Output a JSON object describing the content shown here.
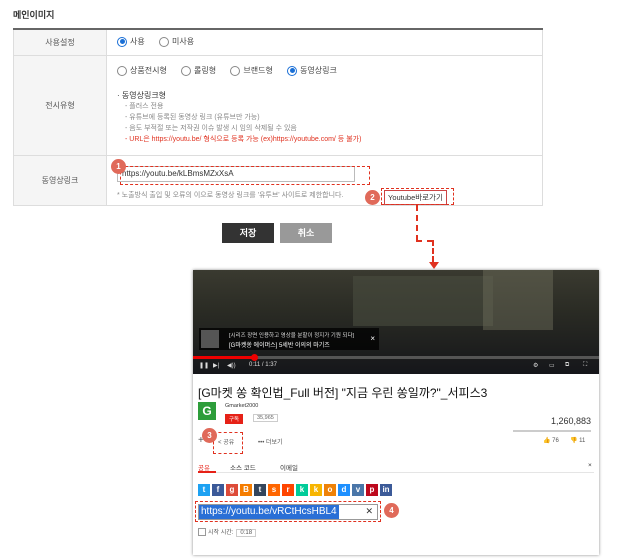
{
  "section_title": "메인이미지",
  "rows": {
    "usage": {
      "label": "사용설정",
      "options": [
        {
          "label": "사용",
          "selected": true
        },
        {
          "label": "미사용",
          "selected": false
        }
      ]
    },
    "display_type": {
      "label": "전시유형",
      "options": [
        {
          "label": "상품전시형",
          "selected": false
        },
        {
          "label": "롤링형",
          "selected": false
        },
        {
          "label": "브랜드형",
          "selected": false
        },
        {
          "label": "동영상링크",
          "selected": true
        }
      ],
      "guide_title": "· 동영상링크형",
      "guide_lines": [
        "- 플러스 전용",
        "- 유튜브에 등록된 동영상 링크 (유튜브만 가능)",
        "- 음도 부적절 또는 저작권 이슈 발생 시 임의 삭제될 수 있음",
        "- URL은 https://youtu.be/ 형식으로 등록 가능 (ex)https://youtube.com/ 등 불가)"
      ]
    },
    "video_link": {
      "label": "동영상링크",
      "input_value": "https://youtu.be/kLBmsMZxXsA",
      "note": "* 노출방식 출입 및 오류의 이으로 동영상 링크를 '유투브' 사이트로 제한합니다.",
      "youtube_link_label": "Youtube바로가기"
    }
  },
  "buttons": {
    "save": "저장",
    "cancel": "취소"
  },
  "badges": [
    "1",
    "2",
    "3",
    "4"
  ],
  "youtube": {
    "ad_line1": "[시리즈 장면 인용하고 영상을 분할이 정지가 기원 되다]",
    "ad_line2": "[G마켓쏭 에이머스] 5세반 이의의 마기즈",
    "progress": 0.15,
    "time": "0:11 / 1:37",
    "title": "[G마켓 쏭 확인법_Full 버전] \"지금 우린 쏭일까?\"_서피스3",
    "channel_logo": "G",
    "channel_name": "Gmarket2000",
    "subscribe": "구독",
    "subscriber_count": "35,965",
    "views": "1,260,883",
    "add_icon": "+",
    "share_label": "공유",
    "more_label": "••• 더보기",
    "likes": "76",
    "dislikes": "11",
    "tabs": [
      "공유",
      "소스 코드",
      "이메일"
    ],
    "close_icon": "×",
    "social_colors": [
      "#1da1f2",
      "#3b5998",
      "#dd4b39",
      "#f57d00",
      "#35465c",
      "#ff6600",
      "#ff4500",
      "#0c9",
      "#f7b500",
      "#ee8208",
      "#1e90ff",
      "#4a76a8",
      "#bd081c",
      "#3c5a98"
    ],
    "share_url": "https://youtu.be/vRCtHcsHBL4",
    "clear_icon": "✕",
    "start_time_label": "시작 시간:",
    "start_time_value": "0:18"
  }
}
